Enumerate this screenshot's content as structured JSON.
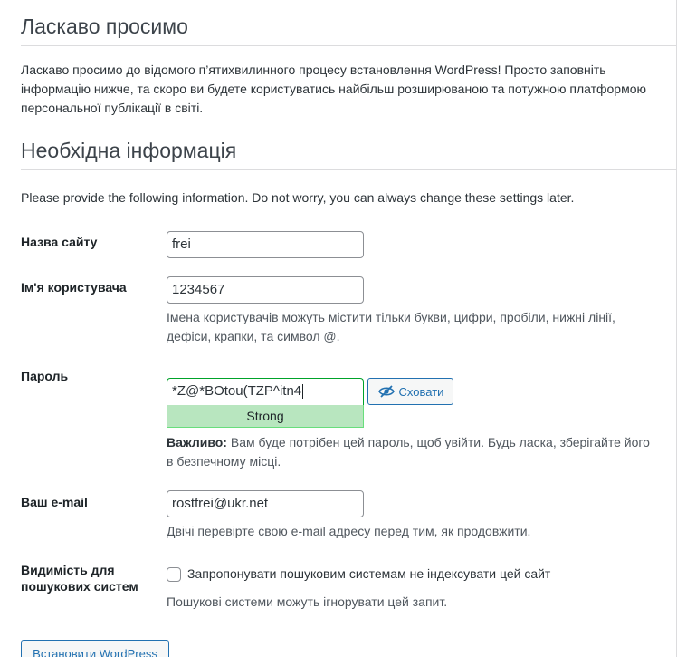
{
  "welcome": {
    "title": "Ласкаво просимо",
    "text": "Ласкаво просимо до відомого п’ятихвилинного процесу встановлення WordPress! Просто заповніть інформацію нижче, та скоро ви будете користуватись найбільш розширюваною та потужною платформою персональної публікації в світі."
  },
  "required": {
    "title": "Необхідна інформація",
    "text": "Please provide the following information. Do not worry, you can always change these settings later."
  },
  "fields": {
    "site_title": {
      "label": "Назва сайту",
      "value": "frei"
    },
    "username": {
      "label": "Ім'я користувача",
      "value": "1234567",
      "hint": "Імена користувачів можуть містити тільки букви, цифри, пробіли, нижні лінії, дефіси, крапки, та символ @."
    },
    "password": {
      "label": "Пароль",
      "value": "*Z@*BOtou(TZP^itn4",
      "strength": "Strong",
      "hide_label": "Сховати",
      "hint_bold": "Важливо:",
      "hint": " Вам буде потрібен цей пароль, щоб увійти. Будь ласка, зберігайте його в безпечному місці."
    },
    "email": {
      "label": "Ваш e-mail",
      "value": "rostfrei@ukr.net",
      "hint": "Двічі перевірте свою e-mail адресу перед тим, як продовжити."
    },
    "visibility": {
      "label_line1": "Видимість для",
      "label_line2": "пошукових систем",
      "checkbox_label": "Запропонувати пошуковим системам не індексувати цей сайт",
      "checked": false,
      "hint": "Пошукові системи можуть ігнорувати цей запит."
    }
  },
  "submit_label": "Встановити WordPress",
  "colors": {
    "accent": "#2271b1",
    "strength_bg": "#b8e6bf",
    "strength_border": "#68de7c"
  },
  "icons": {
    "hide": "eye-slash-icon"
  }
}
